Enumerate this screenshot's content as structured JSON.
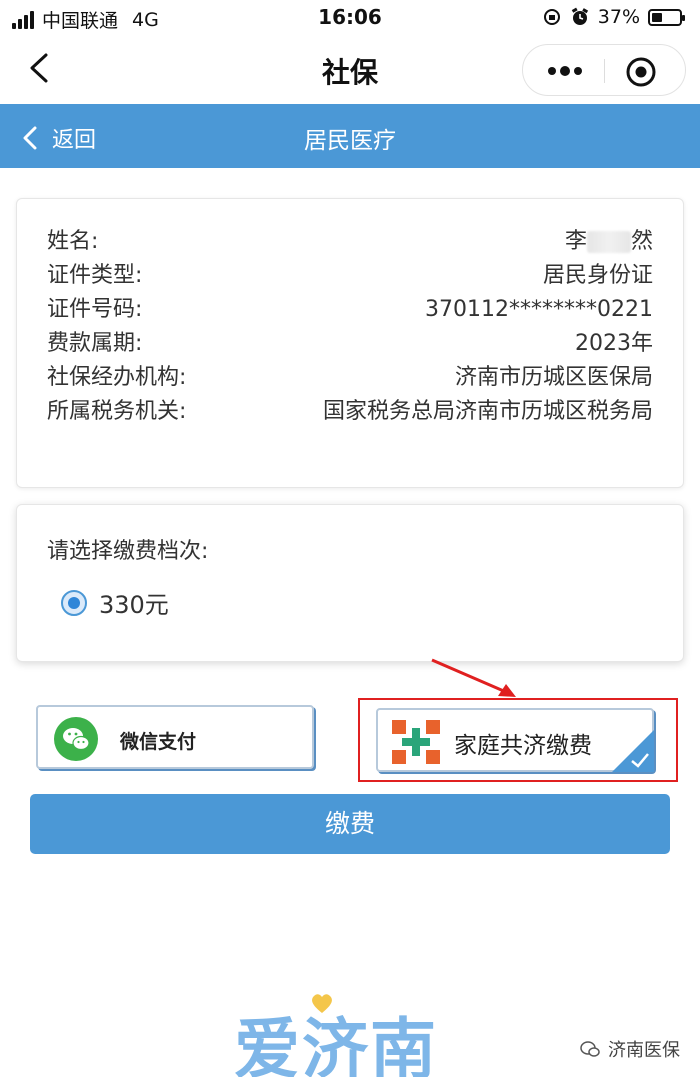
{
  "status_bar": {
    "carrier": "中国联通",
    "network": "4G",
    "time": "16:06",
    "battery": "37%",
    "battery_level": 0.37
  },
  "nav": {
    "title": "社保"
  },
  "header": {
    "back_label": "返回",
    "title": "居民医疗"
  },
  "info": {
    "rows": [
      {
        "label": "姓名:",
        "value_prefix": "李",
        "value_suffix": "然"
      },
      {
        "label": "证件类型:",
        "value": "居民身份证"
      },
      {
        "label": "证件号码:",
        "value": "370112********0221"
      },
      {
        "label": "费款属期:",
        "value": "2023年"
      },
      {
        "label": "社保经办机构:",
        "value": "济南市历城区医保局"
      },
      {
        "label": "所属税务机关:",
        "value": "国家税务总局济南市历城区税务局"
      }
    ]
  },
  "tier": {
    "prompt": "请选择缴费档次:",
    "option": "330元"
  },
  "payment": {
    "wechat_label": "微信支付",
    "family_label": "家庭共济缴费"
  },
  "submit_label": "缴费",
  "watermark": {
    "brand": "爱济南",
    "account": "济南医保"
  },
  "colors": {
    "primary": "#4b98d6",
    "highlight": "#e02020",
    "wechat_green": "#3cb14a",
    "family_orange": "#e8622c",
    "family_green": "#2aa57a"
  }
}
